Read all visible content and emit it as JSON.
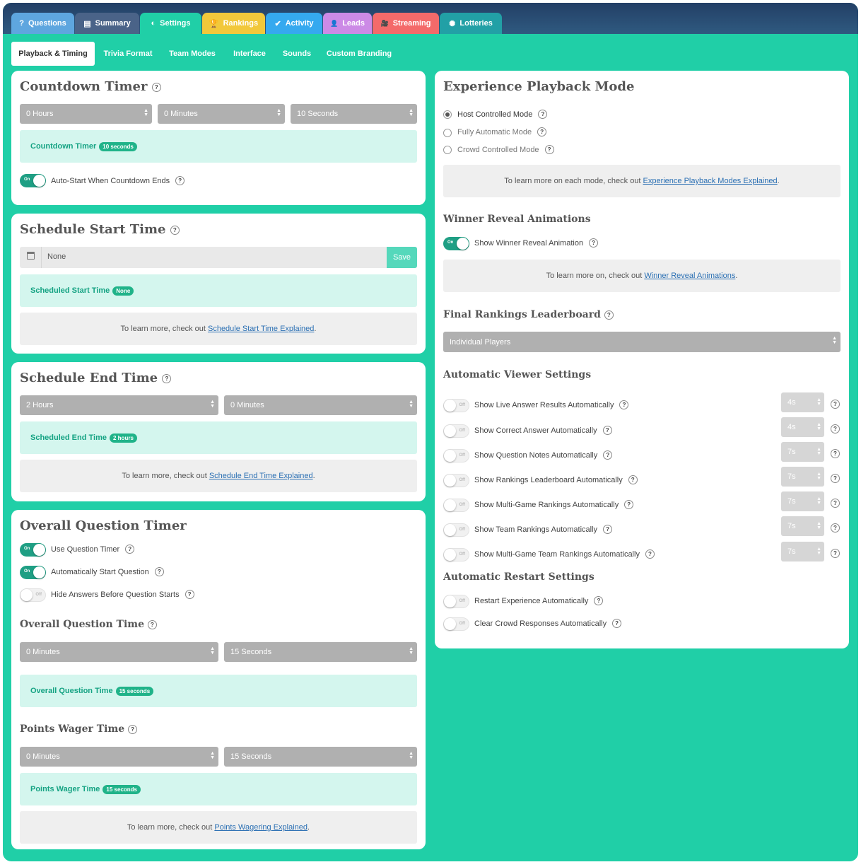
{
  "tabs": [
    {
      "label": "Questions",
      "icon": "?",
      "color": "#5ea6df"
    },
    {
      "label": "Summary",
      "icon": "▤",
      "color": "#4a6388"
    },
    {
      "label": "Settings",
      "icon": "◐",
      "color": "#20cfa7"
    },
    {
      "label": "Rankings",
      "icon": "🏆",
      "color": "#f2c83b"
    },
    {
      "label": "Activity",
      "icon": "✔",
      "color": "#35a9ef"
    },
    {
      "label": "Leads",
      "icon": "👤",
      "color": "#cc8ae6"
    },
    {
      "label": "Streaming",
      "icon": "🎥",
      "color": "#f46a6a"
    },
    {
      "label": "Lotteries",
      "icon": "✺",
      "color": "#22a0a6"
    }
  ],
  "subtabs": [
    "Playback & Timing",
    "Trivia Format",
    "Team Modes",
    "Interface",
    "Sounds",
    "Custom Branding"
  ],
  "countdown": {
    "title": "Countdown Timer",
    "hours": "0 Hours",
    "minutes": "0 Minutes",
    "seconds": "10 Seconds",
    "info_label": "Countdown Timer",
    "info_badge": "10 seconds",
    "toggle_on": "On",
    "autostart": "Auto-Start When Countdown Ends"
  },
  "start": {
    "title": "Schedule Start Time",
    "value": "None",
    "save": "Save",
    "info_label": "Scheduled Start Time",
    "info_badge": "None",
    "note": "To learn more, check out",
    "link": "Schedule Start Time Explained",
    "period": "."
  },
  "end": {
    "title": "Schedule End Time",
    "hours": "2 Hours",
    "minutes": "0 Minutes",
    "info_label": "Scheduled End Time",
    "info_badge": "2 hours",
    "note": "To learn more, check out",
    "link": "Schedule End Time Explained",
    "period": "."
  },
  "overall": {
    "title": "Overall Question Timer",
    "use_timer": "Use Question Timer",
    "auto_start": "Automatically Start Question",
    "hide_answers": "Hide Answers Before Question Starts",
    "on": "On",
    "off": "Off",
    "time_title": "Overall Question Time",
    "minutes": "0 Minutes",
    "seconds": "15 Seconds",
    "info_label": "Overall Question Time",
    "info_badge": "15 seconds",
    "wager_title": "Points Wager Time",
    "wager_minutes": "0 Minutes",
    "wager_seconds": "15 Seconds",
    "wager_label": "Points Wager Time",
    "wager_badge": "15 seconds",
    "note": "To learn more, check out",
    "link": "Points Wagering Explained",
    "period": "."
  },
  "playback": {
    "title": "Experience Playback Mode",
    "modes": [
      "Host Controlled Mode",
      "Fully Automatic Mode",
      "Crowd Controlled Mode"
    ],
    "selected": "Host Controlled Mode",
    "note": "To learn more on each mode, check out",
    "link": "Experience Playback Modes Explained",
    "period": "."
  },
  "winner": {
    "title": "Winner Reveal Animations",
    "toggle": "Show Winner Reveal Animation",
    "on": "On",
    "note": "To learn more on, check out",
    "link": "Winner Reveal Animations",
    "period": "."
  },
  "leaderboard": {
    "title": "Final Rankings Leaderboard",
    "value": "Individual Players"
  },
  "viewer": {
    "title": "Automatic Viewer Settings",
    "off": "Off",
    "items": [
      {
        "label": "Show Live Answer Results Automatically",
        "time": "4s"
      },
      {
        "label": "Show Correct Answer Automatically",
        "time": "4s"
      },
      {
        "label": "Show Question Notes Automatically",
        "time": "7s"
      },
      {
        "label": "Show Rankings Leaderboard Automatically",
        "time": "7s"
      },
      {
        "label": "Show Multi-Game Rankings Automatically",
        "time": "7s"
      },
      {
        "label": "Show Team Rankings Automatically",
        "time": "7s"
      },
      {
        "label": "Show Multi-Game Team Rankings Automatically",
        "time": "7s"
      }
    ]
  },
  "restart": {
    "title": "Automatic Restart Settings",
    "items": [
      "Restart Experience Automatically",
      "Clear Crowd Responses Automatically"
    ]
  },
  "help_glyph": "?"
}
